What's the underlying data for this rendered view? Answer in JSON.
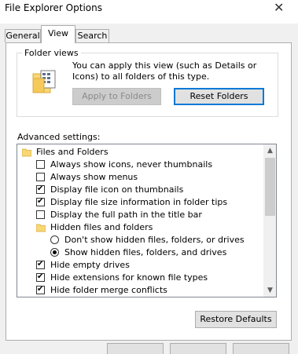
{
  "window": {
    "title": "File Explorer Options"
  },
  "tabs": [
    {
      "label": "General",
      "active": false
    },
    {
      "label": "View",
      "active": true
    },
    {
      "label": "Search",
      "active": false
    }
  ],
  "folder_views": {
    "legend": "Folder views",
    "description": "You can apply this view (such as Details or Icons) to all folders of this type.",
    "apply_label": "Apply to Folders",
    "reset_label": "Reset Folders"
  },
  "advanced": {
    "label": "Advanced settings:",
    "items": [
      {
        "type": "folder",
        "text": "Files and Folders"
      },
      {
        "type": "checkbox",
        "text": "Always show icons, never thumbnails",
        "checked": false
      },
      {
        "type": "checkbox",
        "text": "Always show menus",
        "checked": false
      },
      {
        "type": "checkbox",
        "text": "Display file icon on thumbnails",
        "checked": true
      },
      {
        "type": "checkbox",
        "text": "Display file size information in folder tips",
        "checked": true
      },
      {
        "type": "checkbox",
        "text": "Display the full path in the title bar",
        "checked": false
      },
      {
        "type": "folder",
        "text": "Hidden files and folders"
      },
      {
        "type": "radio",
        "text": "Don't show hidden files, folders, or drives",
        "checked": false
      },
      {
        "type": "radio",
        "text": "Show hidden files, folders, and drives",
        "checked": true
      },
      {
        "type": "checkbox",
        "text": "Hide empty drives",
        "checked": true
      },
      {
        "type": "checkbox",
        "text": "Hide extensions for known file types",
        "checked": true
      },
      {
        "type": "checkbox",
        "text": "Hide folder merge conflicts",
        "checked": true
      }
    ]
  },
  "restore_defaults_label": "Restore Defaults",
  "colors": {
    "accent": "#0078d7",
    "folder": "#f8d775"
  }
}
